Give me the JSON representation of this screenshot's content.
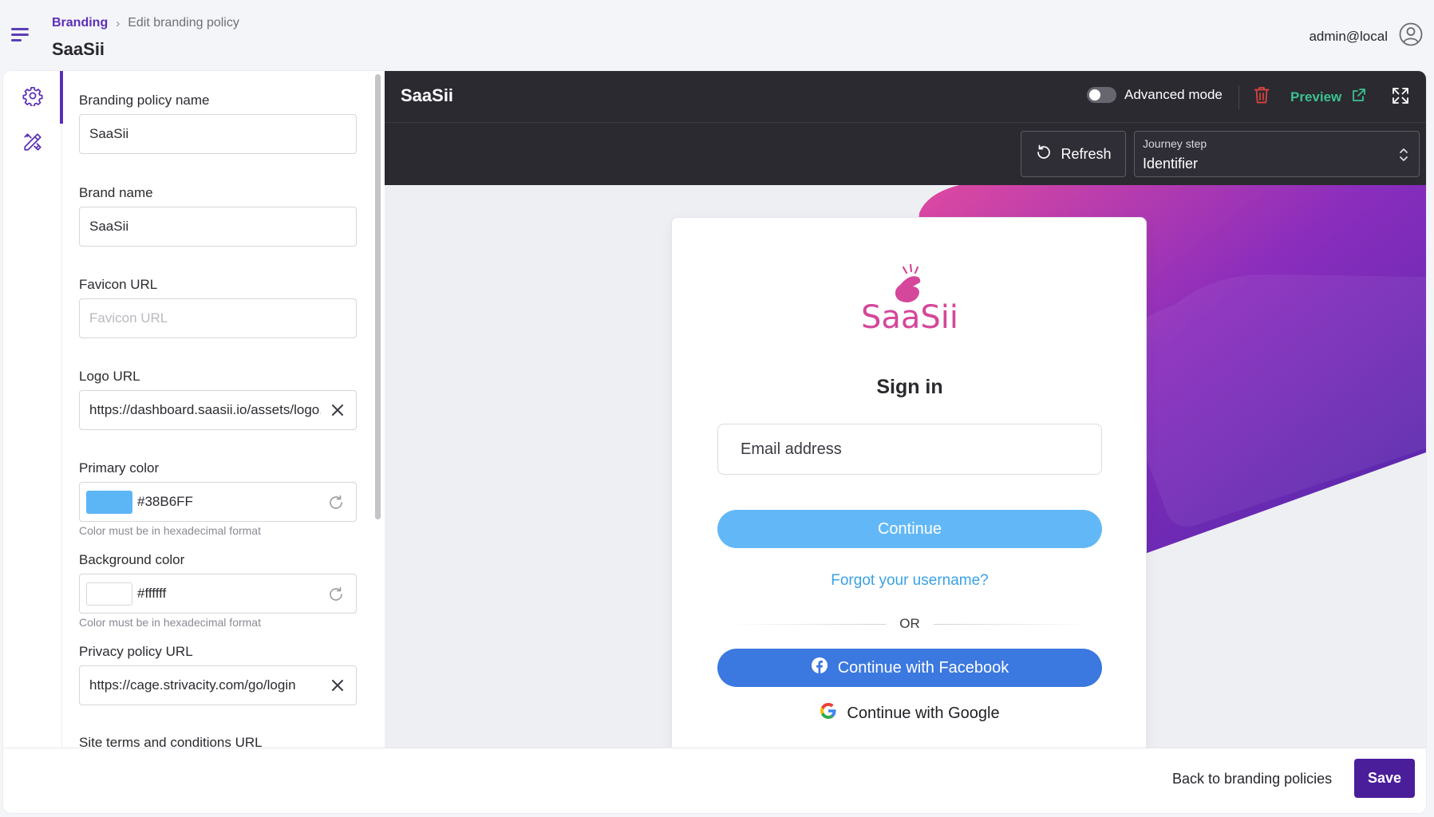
{
  "header": {
    "breadcrumb": {
      "link": "Branding",
      "separator": "›",
      "current": "Edit branding policy"
    },
    "page_title": "SaaSii",
    "user": "admin@local"
  },
  "rail": {
    "items": [
      {
        "icon": "gear-icon",
        "active": true
      },
      {
        "icon": "design-tools-icon",
        "active": false
      }
    ]
  },
  "form": {
    "policy_name": {
      "label": "Branding policy name",
      "value": "SaaSii"
    },
    "brand_name": {
      "label": "Brand name",
      "value": "SaaSii"
    },
    "favicon_url": {
      "label": "Favicon URL",
      "value": "",
      "placeholder": "Favicon URL"
    },
    "logo_url": {
      "label": "Logo URL",
      "value": "https://dashboard.saasii.io/assets/logo.png"
    },
    "primary_color": {
      "label": "Primary color",
      "value": "#38B6FF",
      "swatch": "#5cb6f6",
      "helper": "Color must be in hexadecimal format"
    },
    "background_color": {
      "label": "Background color",
      "value": "#ffffff",
      "swatch": "#ffffff",
      "helper": "Color must be in hexadecimal format"
    },
    "privacy_url": {
      "label": "Privacy policy URL",
      "value": "https://cage.strivacity.com/go/login"
    },
    "terms_url": {
      "label": "Site terms and conditions URL"
    }
  },
  "preview": {
    "title": "SaaSii",
    "advanced_mode": {
      "label": "Advanced mode",
      "enabled": false
    },
    "preview_label": "Preview",
    "refresh_label": "Refresh",
    "journey_step": {
      "label": "Journey step",
      "value": "Identifier"
    }
  },
  "login": {
    "logo_text": "SaaSii",
    "heading": "Sign in",
    "email_placeholder": "Email address",
    "continue_label": "Continue",
    "forgot_label": "Forgot your username?",
    "or_label": "OR",
    "facebook_label": "Continue with Facebook",
    "google_label": "Continue with Google"
  },
  "footer": {
    "back_label": "Back to branding policies",
    "save_label": "Save"
  },
  "colors": {
    "brand_purple": "#5b2fb5",
    "save_purple": "#4a1d9a",
    "preview_green": "#3cc28f",
    "delete_red": "#e0443e",
    "primary_blue": "#62b8f6",
    "facebook_blue": "#3b78e0",
    "logo_pink": "#d4479a",
    "dark_header": "#2b2a31"
  }
}
